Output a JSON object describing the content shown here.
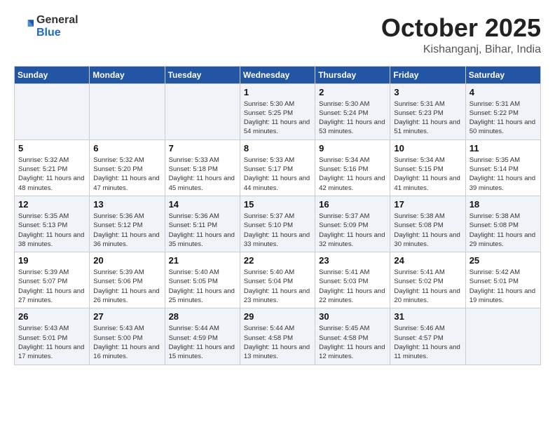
{
  "header": {
    "logo": {
      "general": "General",
      "blue": "Blue"
    },
    "title": "October 2025",
    "location": "Kishanganj, Bihar, India"
  },
  "weekdays": [
    "Sunday",
    "Monday",
    "Tuesday",
    "Wednesday",
    "Thursday",
    "Friday",
    "Saturday"
  ],
  "weeks": [
    [
      null,
      null,
      null,
      {
        "day": 1,
        "sunrise": "Sunrise: 5:30 AM",
        "sunset": "Sunset: 5:25 PM",
        "daylight": "Daylight: 11 hours and 54 minutes."
      },
      {
        "day": 2,
        "sunrise": "Sunrise: 5:30 AM",
        "sunset": "Sunset: 5:24 PM",
        "daylight": "Daylight: 11 hours and 53 minutes."
      },
      {
        "day": 3,
        "sunrise": "Sunrise: 5:31 AM",
        "sunset": "Sunset: 5:23 PM",
        "daylight": "Daylight: 11 hours and 51 minutes."
      },
      {
        "day": 4,
        "sunrise": "Sunrise: 5:31 AM",
        "sunset": "Sunset: 5:22 PM",
        "daylight": "Daylight: 11 hours and 50 minutes."
      }
    ],
    [
      {
        "day": 5,
        "sunrise": "Sunrise: 5:32 AM",
        "sunset": "Sunset: 5:21 PM",
        "daylight": "Daylight: 11 hours and 48 minutes."
      },
      {
        "day": 6,
        "sunrise": "Sunrise: 5:32 AM",
        "sunset": "Sunset: 5:20 PM",
        "daylight": "Daylight: 11 hours and 47 minutes."
      },
      {
        "day": 7,
        "sunrise": "Sunrise: 5:33 AM",
        "sunset": "Sunset: 5:18 PM",
        "daylight": "Daylight: 11 hours and 45 minutes."
      },
      {
        "day": 8,
        "sunrise": "Sunrise: 5:33 AM",
        "sunset": "Sunset: 5:17 PM",
        "daylight": "Daylight: 11 hours and 44 minutes."
      },
      {
        "day": 9,
        "sunrise": "Sunrise: 5:34 AM",
        "sunset": "Sunset: 5:16 PM",
        "daylight": "Daylight: 11 hours and 42 minutes."
      },
      {
        "day": 10,
        "sunrise": "Sunrise: 5:34 AM",
        "sunset": "Sunset: 5:15 PM",
        "daylight": "Daylight: 11 hours and 41 minutes."
      },
      {
        "day": 11,
        "sunrise": "Sunrise: 5:35 AM",
        "sunset": "Sunset: 5:14 PM",
        "daylight": "Daylight: 11 hours and 39 minutes."
      }
    ],
    [
      {
        "day": 12,
        "sunrise": "Sunrise: 5:35 AM",
        "sunset": "Sunset: 5:13 PM",
        "daylight": "Daylight: 11 hours and 38 minutes."
      },
      {
        "day": 13,
        "sunrise": "Sunrise: 5:36 AM",
        "sunset": "Sunset: 5:12 PM",
        "daylight": "Daylight: 11 hours and 36 minutes."
      },
      {
        "day": 14,
        "sunrise": "Sunrise: 5:36 AM",
        "sunset": "Sunset: 5:11 PM",
        "daylight": "Daylight: 11 hours and 35 minutes."
      },
      {
        "day": 15,
        "sunrise": "Sunrise: 5:37 AM",
        "sunset": "Sunset: 5:10 PM",
        "daylight": "Daylight: 11 hours and 33 minutes."
      },
      {
        "day": 16,
        "sunrise": "Sunrise: 5:37 AM",
        "sunset": "Sunset: 5:09 PM",
        "daylight": "Daylight: 11 hours and 32 minutes."
      },
      {
        "day": 17,
        "sunrise": "Sunrise: 5:38 AM",
        "sunset": "Sunset: 5:08 PM",
        "daylight": "Daylight: 11 hours and 30 minutes."
      },
      {
        "day": 18,
        "sunrise": "Sunrise: 5:38 AM",
        "sunset": "Sunset: 5:08 PM",
        "daylight": "Daylight: 11 hours and 29 minutes."
      }
    ],
    [
      {
        "day": 19,
        "sunrise": "Sunrise: 5:39 AM",
        "sunset": "Sunset: 5:07 PM",
        "daylight": "Daylight: 11 hours and 27 minutes."
      },
      {
        "day": 20,
        "sunrise": "Sunrise: 5:39 AM",
        "sunset": "Sunset: 5:06 PM",
        "daylight": "Daylight: 11 hours and 26 minutes."
      },
      {
        "day": 21,
        "sunrise": "Sunrise: 5:40 AM",
        "sunset": "Sunset: 5:05 PM",
        "daylight": "Daylight: 11 hours and 25 minutes."
      },
      {
        "day": 22,
        "sunrise": "Sunrise: 5:40 AM",
        "sunset": "Sunset: 5:04 PM",
        "daylight": "Daylight: 11 hours and 23 minutes."
      },
      {
        "day": 23,
        "sunrise": "Sunrise: 5:41 AM",
        "sunset": "Sunset: 5:03 PM",
        "daylight": "Daylight: 11 hours and 22 minutes."
      },
      {
        "day": 24,
        "sunrise": "Sunrise: 5:41 AM",
        "sunset": "Sunset: 5:02 PM",
        "daylight": "Daylight: 11 hours and 20 minutes."
      },
      {
        "day": 25,
        "sunrise": "Sunrise: 5:42 AM",
        "sunset": "Sunset: 5:01 PM",
        "daylight": "Daylight: 11 hours and 19 minutes."
      }
    ],
    [
      {
        "day": 26,
        "sunrise": "Sunrise: 5:43 AM",
        "sunset": "Sunset: 5:01 PM",
        "daylight": "Daylight: 11 hours and 17 minutes."
      },
      {
        "day": 27,
        "sunrise": "Sunrise: 5:43 AM",
        "sunset": "Sunset: 5:00 PM",
        "daylight": "Daylight: 11 hours and 16 minutes."
      },
      {
        "day": 28,
        "sunrise": "Sunrise: 5:44 AM",
        "sunset": "Sunset: 4:59 PM",
        "daylight": "Daylight: 11 hours and 15 minutes."
      },
      {
        "day": 29,
        "sunrise": "Sunrise: 5:44 AM",
        "sunset": "Sunset: 4:58 PM",
        "daylight": "Daylight: 11 hours and 13 minutes."
      },
      {
        "day": 30,
        "sunrise": "Sunrise: 5:45 AM",
        "sunset": "Sunset: 4:58 PM",
        "daylight": "Daylight: 11 hours and 12 minutes."
      },
      {
        "day": 31,
        "sunrise": "Sunrise: 5:46 AM",
        "sunset": "Sunset: 4:57 PM",
        "daylight": "Daylight: 11 hours and 11 minutes."
      },
      null
    ]
  ]
}
